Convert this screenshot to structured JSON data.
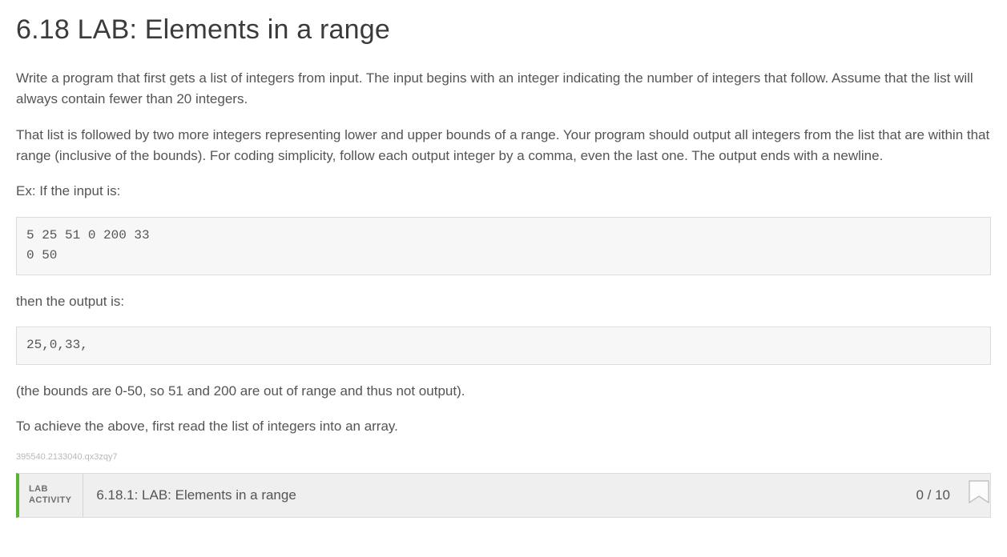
{
  "title": "6.18 LAB: Elements in a range",
  "paragraphs": {
    "p1": "Write a program that first gets a list of integers from input. The input begins with an integer indicating the number of integers that follow. Assume that the list will always contain fewer than 20 integers.",
    "p2": "That list is followed by two more integers representing lower and upper bounds of a range. Your program should output all integers from the list that are within that range (inclusive of the bounds). For coding simplicity, follow each output integer by a comma, even the last one. The output ends with a newline.",
    "p3": "Ex: If the input is:",
    "p4": "then the output is:",
    "p5": "(the bounds are 0-50, so 51 and 200 are out of range and thus not output).",
    "p6": "To achieve the above, first read the list of integers into an array."
  },
  "code_input": "5 25 51 0 200 33\n0 50",
  "code_output": "25,0,33,",
  "meta_id": "395540.2133040.qx3zqy7",
  "lab": {
    "label_line1": "LAB",
    "label_line2": "ACTIVITY",
    "title": "6.18.1: LAB: Elements in a range",
    "score": "0 / 10"
  }
}
